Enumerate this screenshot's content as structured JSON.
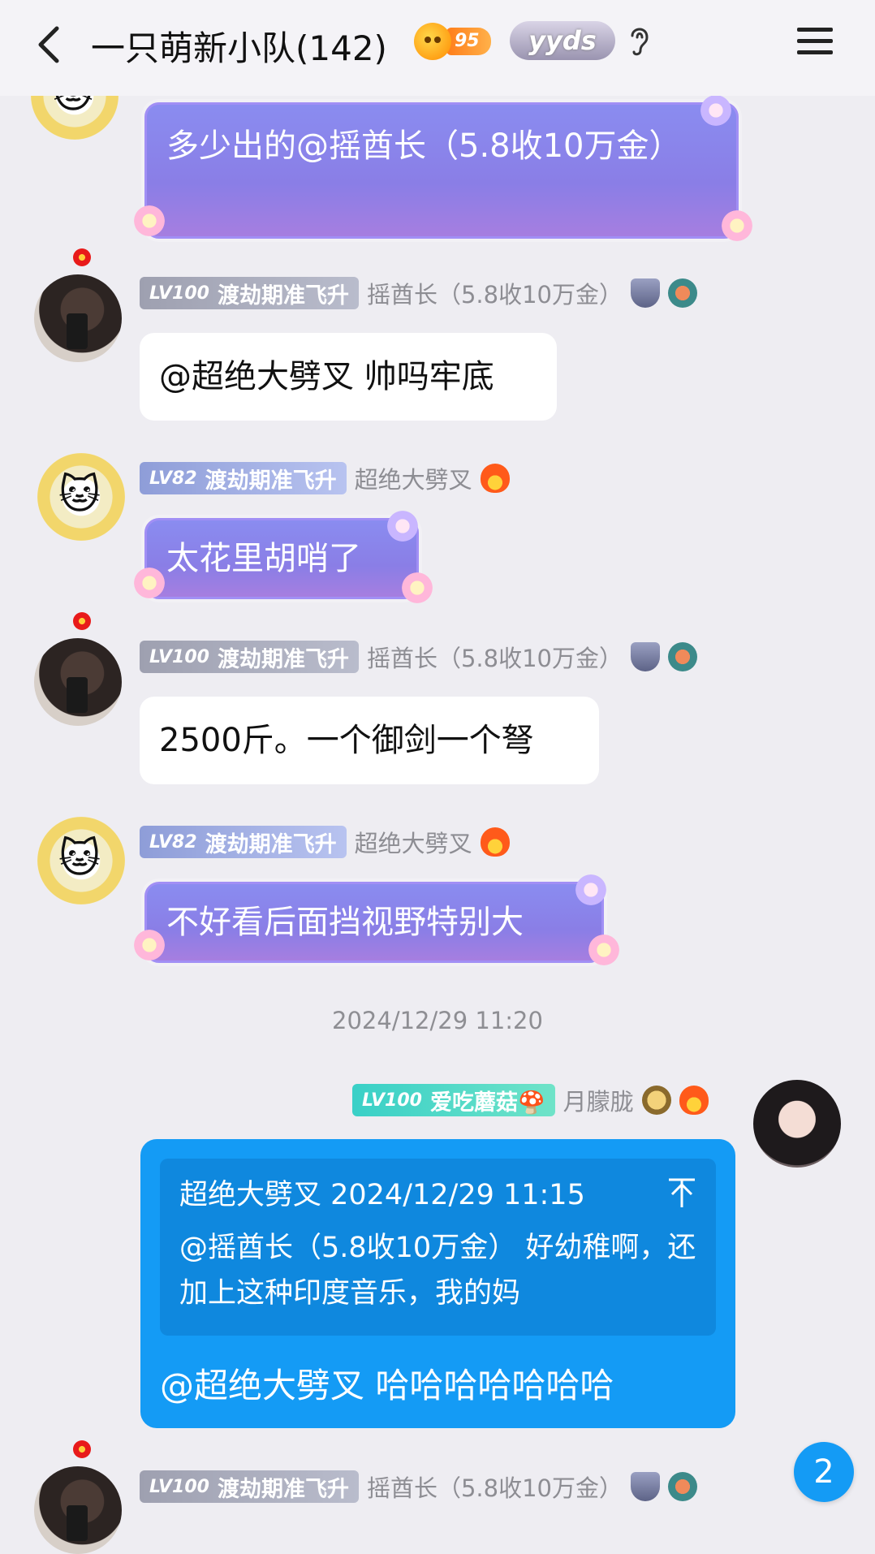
{
  "header": {
    "title": "一只萌新小队(142)",
    "fire_level": "95",
    "yyds_badge": "yyds"
  },
  "messages": [
    {
      "user": "超绝大劈叉",
      "avatar": "cat-avatar",
      "text": "多少出的@摇酋长（5.8收10万金）"
    },
    {
      "user": "摇酋长（5.8收10万金）",
      "avatar": "boy-avatar",
      "level": "LV100",
      "title": "渡劫期准飞升",
      "text": "@超绝大劈叉 帅吗牢底"
    },
    {
      "user": "超绝大劈叉",
      "avatar": "cat-avatar",
      "level": "LV82",
      "title": "渡劫期准飞升",
      "text": "太花里胡哨了"
    },
    {
      "user": "摇酋长（5.8收10万金）",
      "avatar": "boy-avatar",
      "level": "LV100",
      "title": "渡劫期准飞升",
      "text": "2500斤。一个御剑一个弩"
    },
    {
      "user": "超绝大劈叉",
      "avatar": "cat-avatar",
      "level": "LV82",
      "title": "渡劫期准飞升",
      "text": "不好看后面挡视野特别大"
    }
  ],
  "timestamp": "2024/12/29 11:20",
  "reply_message": {
    "user": "月朦胧",
    "level": "LV100",
    "title": "爱吃蘑菇🍄",
    "quote_header": "超绝大劈叉 2024/12/29 11:15",
    "quote_text": "@摇酋长（5.8收10万金） 好幼稚啊，还加上这种印度音乐，我的妈",
    "text": "@超绝大劈叉 哈哈哈哈哈哈哈"
  },
  "last_message": {
    "user": "摇酋长（5.8收10万金）",
    "level": "LV100",
    "title": "渡劫期准飞升"
  },
  "unread_count": "2",
  "icons": {
    "back": "chevron-left-icon",
    "ear": "ear-icon",
    "menu": "hamburger-menu-icon"
  }
}
